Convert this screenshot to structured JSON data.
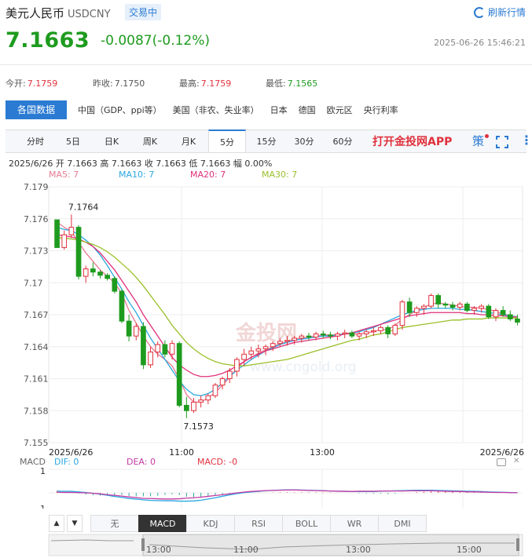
{
  "header": {
    "name": "美元人民币",
    "code": "USDCNY",
    "status_badge": "交易中",
    "refresh_label": "刷新行情",
    "price": "7.1663",
    "change": "-0.0087(-0.12%)",
    "timestamp": "2025-06-26 15:46:21"
  },
  "quote": {
    "open_label": "今开:",
    "open": "7.1759",
    "prev_close_label": "昨收:",
    "prev_close": "7.1750",
    "high_label": "最高:",
    "high": "7.1759",
    "low_label": "最低:",
    "low": "7.1565"
  },
  "nav": {
    "active": "各国数据",
    "items": [
      "中国（GDP、ppi等）",
      "美国（非农、失业率）",
      "日本",
      "德国",
      "欧元区",
      "央行利率"
    ]
  },
  "periods": {
    "items": [
      "分时",
      "5日",
      "日K",
      "周K",
      "月K",
      "5分",
      "15分",
      "30分",
      "60分"
    ],
    "active_index": 5,
    "app_label": "打开金投网APP",
    "strategy_label": "策"
  },
  "ohlc_line": "2025/6/26  开 7.1663  高 7.1663  收 7.1663  低 7.1663  幅 0.00%",
  "ma_labels": [
    {
      "text": "MA5: 7",
      "color": "#e87a90"
    },
    {
      "text": "MA10: 7",
      "color": "#2aa8e0"
    },
    {
      "text": "MA20: 7",
      "color": "#e0307a"
    },
    {
      "text": "MA30: 7",
      "color": "#9ac02a"
    }
  ],
  "macd_labels": {
    "title": "MACD",
    "dif": "DIF: 0",
    "dea": "DEA: 0",
    "macd": "MACD: -0"
  },
  "subtabs": [
    "无",
    "MACD",
    "KDJ",
    "RSI",
    "BOLL",
    "WR",
    "DMI"
  ],
  "subtab_active": 1,
  "watermark": "www.cngold.org",
  "watermark_brand": "金投网",
  "colors": {
    "up": "#e0303c",
    "down": "#1e9b1e",
    "accent": "#2b7bd3"
  },
  "chart_data": {
    "type": "candlestick",
    "ylim": [
      7.155,
      7.179
    ],
    "y_ticks": [
      "7.179",
      "7.176",
      "7.173",
      "7.17",
      "7.167",
      "7.164",
      "7.161",
      "7.158",
      "7.155"
    ],
    "x_labels": [
      "2025/6/26",
      "11:00",
      "13:00",
      "2025/6/26"
    ],
    "annotations": [
      {
        "text": "7.1764",
        "bar": 2
      },
      {
        "text": "7.1573",
        "bar": 18
      }
    ],
    "candles": [
      [
        7.1759,
        7.1759,
        7.1733,
        7.1733
      ],
      [
        7.1733,
        7.1749,
        7.1731,
        7.1745
      ],
      [
        7.1745,
        7.1764,
        7.1742,
        7.1752
      ],
      [
        7.1752,
        7.1754,
        7.1703,
        7.1706
      ],
      [
        7.1706,
        7.1716,
        7.17,
        7.1713
      ],
      [
        7.1713,
        7.1719,
        7.1706,
        7.171
      ],
      [
        7.171,
        7.1712,
        7.1704,
        7.1707
      ],
      [
        7.1707,
        7.1709,
        7.1702,
        7.1704
      ],
      [
        7.1704,
        7.1706,
        7.169,
        7.1692
      ],
      [
        7.1692,
        7.1694,
        7.1662,
        7.1664
      ],
      [
        7.1664,
        7.167,
        7.1645,
        7.165
      ],
      [
        7.165,
        7.1662,
        7.1646,
        7.1659
      ],
      [
        7.1659,
        7.1663,
        7.1619,
        7.1623
      ],
      [
        7.1623,
        7.164,
        7.162,
        7.1635
      ],
      [
        7.1635,
        7.1645,
        7.163,
        7.1642
      ],
      [
        7.1642,
        7.1646,
        7.163,
        7.1633
      ],
      [
        7.1633,
        7.1646,
        7.1628,
        7.1643
      ],
      [
        7.1643,
        7.1645,
        7.1583,
        7.1585
      ],
      [
        7.1585,
        7.1593,
        7.1573,
        7.158
      ],
      [
        7.158,
        7.1592,
        7.1578,
        7.1588
      ],
      [
        7.1588,
        7.1594,
        7.1583,
        7.159
      ],
      [
        7.159,
        7.1596,
        7.1586,
        7.1594
      ],
      [
        7.1594,
        7.1606,
        7.1592,
        7.1604
      ],
      [
        7.1604,
        7.1612,
        7.16,
        7.161
      ],
      [
        7.161,
        7.162,
        7.1606,
        7.1617
      ],
      [
        7.1617,
        7.163,
        7.1612,
        7.1628
      ],
      [
        7.1628,
        7.1638,
        7.1622,
        7.1633
      ],
      [
        7.1633,
        7.164,
        7.1628,
        7.1636
      ],
      [
        7.1636,
        7.1642,
        7.163,
        7.1638
      ],
      [
        7.1638,
        7.1642,
        7.1632,
        7.164
      ],
      [
        7.164,
        7.1645,
        7.1636,
        7.1643
      ],
      [
        7.1643,
        7.1648,
        7.164,
        7.1645
      ],
      [
        7.1645,
        7.165,
        7.1641,
        7.1646
      ],
      [
        7.1646,
        7.165,
        7.1642,
        7.1648
      ],
      [
        7.1648,
        7.1652,
        7.1644,
        7.165
      ],
      [
        7.165,
        7.1653,
        7.1646,
        7.1649
      ],
      [
        7.1649,
        7.1654,
        7.1646,
        7.1652
      ],
      [
        7.1652,
        7.1655,
        7.1648,
        7.1651
      ],
      [
        7.1651,
        7.1654,
        7.1647,
        7.165
      ],
      [
        7.165,
        7.1654,
        7.1646,
        7.1652
      ],
      [
        7.1652,
        7.1656,
        7.1648,
        7.1653
      ],
      [
        7.1653,
        7.1655,
        7.1648,
        7.165
      ],
      [
        7.165,
        7.1654,
        7.1646,
        7.1652
      ],
      [
        7.1652,
        7.1656,
        7.1648,
        7.1654
      ],
      [
        7.1654,
        7.1658,
        7.165,
        7.1655
      ],
      [
        7.1655,
        7.166,
        7.1652,
        7.1658
      ],
      [
        7.1658,
        7.166,
        7.1648,
        7.1652
      ],
      [
        7.1652,
        7.1662,
        7.165,
        7.166
      ],
      [
        7.166,
        7.1684,
        7.1656,
        7.1682
      ],
      [
        7.1682,
        7.1686,
        7.1668,
        7.1672
      ],
      [
        7.1672,
        7.1678,
        7.1668,
        7.1676
      ],
      [
        7.1676,
        7.168,
        7.167,
        7.1678
      ],
      [
        7.1678,
        7.169,
        7.1676,
        7.1688
      ],
      [
        7.1688,
        7.169,
        7.1676,
        7.168
      ],
      [
        7.168,
        7.1682,
        7.1676,
        7.1679
      ],
      [
        7.1679,
        7.1682,
        7.1674,
        7.1677
      ],
      [
        7.1677,
        7.1682,
        7.1674,
        7.168
      ],
      [
        7.168,
        7.1682,
        7.1672,
        7.1674
      ],
      [
        7.1674,
        7.1678,
        7.167,
        7.1676
      ],
      [
        7.1676,
        7.168,
        7.1672,
        7.1678
      ],
      [
        7.1678,
        7.168,
        7.1666,
        7.1668
      ],
      [
        7.1668,
        7.1676,
        7.1664,
        7.1674
      ],
      [
        7.1674,
        7.1678,
        7.1668,
        7.167
      ],
      [
        7.167,
        7.1674,
        7.1664,
        7.1666
      ],
      [
        7.1666,
        7.167,
        7.166,
        7.1663
      ]
    ],
    "ma": {
      "MA5": [
        7.1757,
        7.1752,
        7.1748,
        7.1738,
        7.1728,
        7.172,
        7.1712,
        7.1706,
        7.17,
        7.169,
        7.1674,
        7.1662,
        7.165,
        7.164,
        7.1633,
        7.1628,
        7.1622,
        7.161,
        7.1595,
        7.1588,
        7.1588,
        7.1592,
        7.1597,
        7.1604,
        7.1611,
        7.162,
        7.1626,
        7.163,
        7.1634,
        7.1637,
        7.164,
        7.1643,
        7.1645,
        7.1647,
        7.1648,
        7.1649,
        7.165,
        7.1651,
        7.1651,
        7.1651,
        7.1652,
        7.1652,
        7.1652,
        7.1653,
        7.1654,
        7.1656,
        7.1656,
        7.166,
        7.1666,
        7.167,
        7.1674,
        7.1677,
        7.168,
        7.1681,
        7.168,
        7.1679,
        7.1678,
        7.1677,
        7.1677,
        7.1676,
        7.1675,
        7.1673,
        7.1671,
        7.1669,
        7.1667
      ],
      "MA10": [
        7.1752,
        7.175,
        7.1749,
        7.1745,
        7.174,
        7.1734,
        7.1726,
        7.1716,
        7.1705,
        7.1694,
        7.1682,
        7.1672,
        7.166,
        7.1648,
        7.1638,
        7.1628,
        7.1618,
        7.1608,
        7.16,
        7.1595,
        7.1594,
        7.1596,
        7.16,
        7.1606,
        7.1612,
        7.1618,
        7.1623,
        7.1628,
        7.1632,
        7.1636,
        7.1639,
        7.1642,
        7.1644,
        7.1646,
        7.1647,
        7.1648,
        7.1649,
        7.165,
        7.165,
        7.1651,
        7.1652,
        7.1653,
        7.1654,
        7.1656,
        7.1658,
        7.1661,
        7.1664,
        7.1667,
        7.167,
        7.1672,
        7.1674,
        7.1675,
        7.1676,
        7.1676,
        7.1676,
        7.1676,
        7.1675,
        7.1675,
        7.1674,
        7.1673,
        7.1672,
        7.1671,
        7.167,
        7.1669,
        7.1668
      ],
      "MA20": [
        7.1745,
        7.1744,
        7.1743,
        7.1741,
        7.1738,
        7.1734,
        7.1728,
        7.172,
        7.1712,
        7.1702,
        7.1692,
        7.1682,
        7.167,
        7.166,
        7.165,
        7.164,
        7.163,
        7.1623,
        7.1618,
        7.1614,
        7.1612,
        7.1612,
        7.1613,
        7.1615,
        7.1618,
        7.1622,
        7.1626,
        7.163,
        7.1633,
        7.1636,
        7.1638,
        7.164,
        7.1642,
        7.1644,
        7.1645,
        7.1646,
        7.1647,
        7.1648,
        7.1649,
        7.165,
        7.1652,
        7.1653,
        7.1655,
        7.1657,
        7.1659,
        7.1661,
        7.1663,
        7.1665,
        7.1667,
        7.1669,
        7.167,
        7.1671,
        7.1672,
        7.1672,
        7.1672,
        7.1672,
        7.1672,
        7.1671,
        7.1671,
        7.167,
        7.167,
        7.1669,
        7.1669,
        7.1668,
        7.1668
      ],
      "MA30": [
        7.1742,
        7.1742,
        7.1741,
        7.174,
        7.1738,
        7.1736,
        7.1733,
        7.1729,
        7.1724,
        7.1718,
        7.1712,
        7.1705,
        7.1697,
        7.1688,
        7.1679,
        7.167,
        7.166,
        7.1652,
        7.1644,
        7.1638,
        7.1633,
        7.1629,
        7.1626,
        7.1624,
        7.1623,
        7.1622,
        7.1622,
        7.1623,
        7.1624,
        7.1625,
        7.1626,
        7.1627,
        7.1628,
        7.163,
        7.1632,
        7.1634,
        7.1636,
        7.1638,
        7.164,
        7.1642,
        7.1644,
        7.1646,
        7.1647,
        7.1649,
        7.1651,
        7.1652,
        7.1654,
        7.1656,
        7.1658,
        7.1659,
        7.166,
        7.1661,
        7.1662,
        7.1663,
        7.1664,
        7.1665,
        7.1665,
        7.1666,
        7.1666,
        7.1666,
        7.1667,
        7.1667,
        7.1667,
        7.1667,
        7.1667
      ]
    },
    "macd": {
      "ylim": [
        -1,
        1
      ],
      "y_ticks": [
        "1",
        "-1"
      ],
      "navigator_labels": [
        "13:00",
        "11:00",
        "13:00",
        "15:00"
      ]
    }
  }
}
